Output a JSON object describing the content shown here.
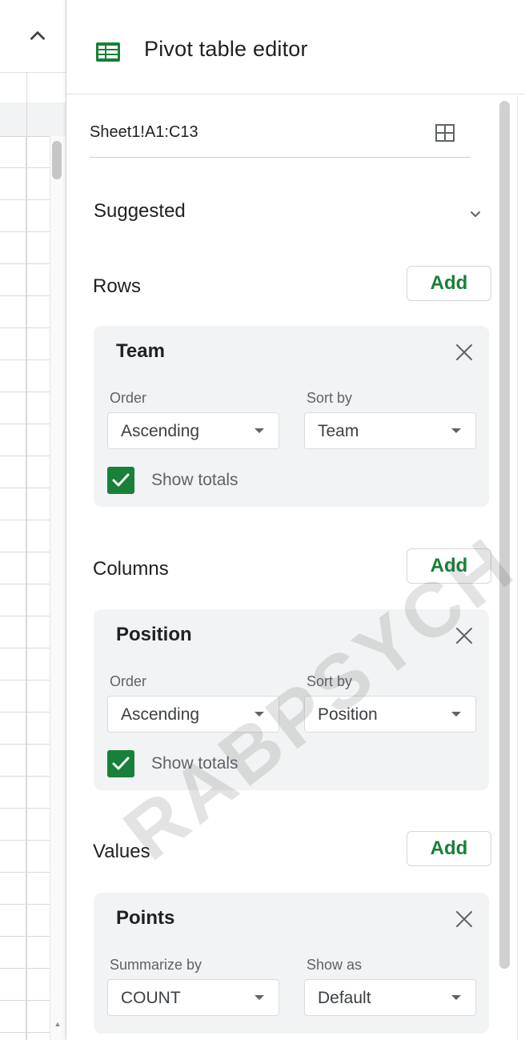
{
  "panel": {
    "title": "Pivot table editor",
    "range": "Sheet1!A1:C13",
    "suggested_label": "Suggested"
  },
  "rows": {
    "label": "Rows",
    "add_label": "Add",
    "card": {
      "title": "Team",
      "order_label": "Order",
      "order_value": "Ascending",
      "sortby_label": "Sort by",
      "sortby_value": "Team",
      "show_totals_label": "Show totals",
      "show_totals_checked": true
    }
  },
  "columns": {
    "label": "Columns",
    "add_label": "Add",
    "card": {
      "title": "Position",
      "order_label": "Order",
      "order_value": "Ascending",
      "sortby_label": "Sort by",
      "sortby_value": "Position",
      "show_totals_label": "Show totals",
      "show_totals_checked": true
    }
  },
  "values": {
    "label": "Values",
    "add_label": "Add",
    "card": {
      "title": "Points",
      "summarize_label": "Summarize by",
      "summarize_value": "COUNT",
      "showas_label": "Show as",
      "showas_value": "Default"
    }
  },
  "watermark": "RABPSYCH",
  "colors": {
    "accent_green": "#188038",
    "card_bg": "#f1f3f4"
  },
  "icons": [
    "chevron-up-icon",
    "sheets-table-icon",
    "grid-select-icon",
    "chevron-down-icon",
    "close-icon",
    "checkmark-icon",
    "dropdown-arrow-icon"
  ]
}
